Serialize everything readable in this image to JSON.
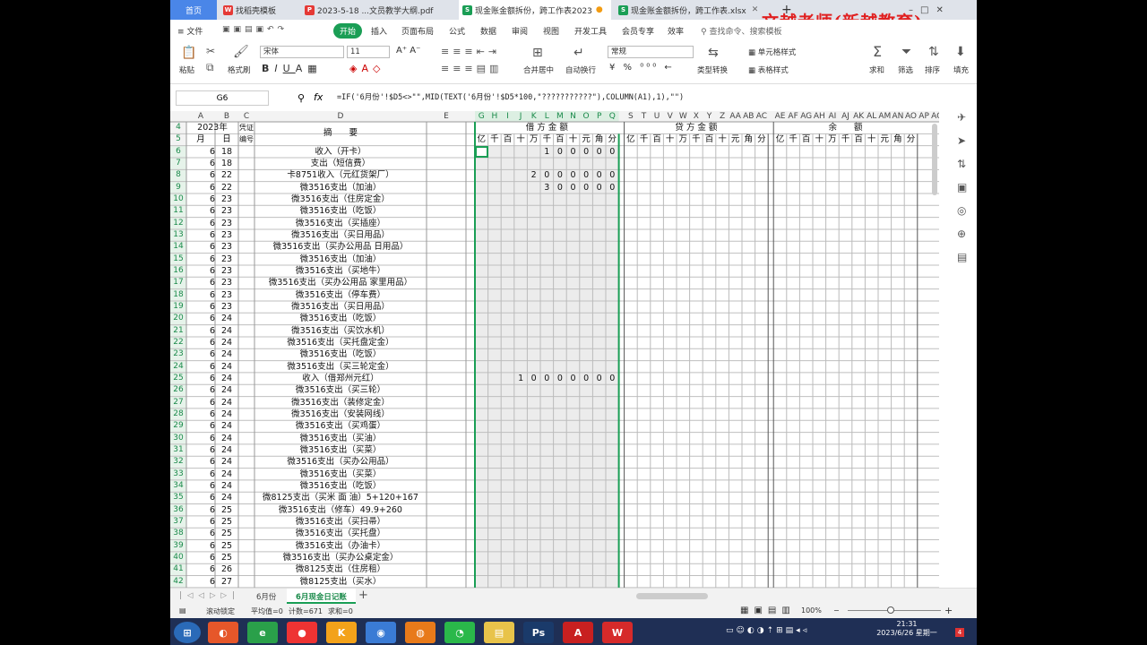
{
  "tabs": [
    {
      "label": "首页"
    },
    {
      "label": "找稻壳模板"
    },
    {
      "label": "2023-5-18 ...文员教学大纲.pdf"
    },
    {
      "label": "现金账金额拆份，跨工作表2023"
    },
    {
      "label": "现金账金额拆份，跨工作表.xlsx"
    }
  ],
  "watermark": "文越老师(新越教育)",
  "menu": {
    "file": "文件",
    "start": "开始",
    "items": [
      "插入",
      "页面布局",
      "公式",
      "数据",
      "审阅",
      "视图",
      "开发工具",
      "会员专享",
      "效率"
    ],
    "search": "查找命令、搜索模板"
  },
  "ribbon": {
    "paste": "粘贴",
    "format_painter": "格式刷",
    "font": "宋体",
    "size": "11",
    "merge": "合并居中",
    "wrap": "自动换行",
    "numfmt": "常规",
    "convert": "类型转换",
    "cond": "单元格样式",
    "table_style": "表格样式",
    "sum": "求和",
    "filter": "筛选",
    "sort": "排序",
    "fill": "填充"
  },
  "formula_bar": {
    "cell_ref": "G6",
    "fx": "fx",
    "formula": "=IF('6月份'!$D5<>\"\",MID(TEXT('6月份'!$D5*100,\"???????????\"),COLUMN(A1),1),\"\")"
  },
  "sheet": {
    "col_letters": [
      "A",
      "B",
      "C",
      "D",
      "E",
      "G",
      "H",
      "I",
      "J",
      "K",
      "L",
      "M",
      "N",
      "O",
      "P",
      "Q",
      "S",
      "T",
      "U",
      "V",
      "W",
      "X",
      "Y",
      "Z",
      "AA",
      "AB",
      "AC",
      "AE",
      "AF",
      "AG",
      "AH",
      "AI",
      "AJ",
      "AK",
      "AL",
      "AM",
      "AN",
      "AO",
      "AP",
      "AQ"
    ],
    "year": "2023年",
    "voucher": "凭证",
    "voucher2": "编号",
    "month": "月",
    "day": "日",
    "summary": "摘　　要",
    "debit": "借 方 金 额",
    "credit": "贷 方 金 额",
    "balance": "余　　额",
    "units": [
      "亿",
      "千",
      "百",
      "十",
      "万",
      "千",
      "百",
      "十",
      "元",
      "角",
      "分"
    ],
    "rows": [
      {
        "n": "6",
        "m": "6",
        "d": "18",
        "s": "收入（开卡）",
        "a": "100000"
      },
      {
        "n": "7",
        "m": "6",
        "d": "18",
        "s": "支出（短信费）",
        "a": ""
      },
      {
        "n": "8",
        "m": "6",
        "d": "22",
        "s": "卡8751收入（元红货架厂）",
        "a": "2000000"
      },
      {
        "n": "9",
        "m": "6",
        "d": "22",
        "s": "微3516支出（加油）",
        "a": "300000"
      },
      {
        "n": "10",
        "m": "6",
        "d": "23",
        "s": "微3516支出（住房定金）",
        "a": ""
      },
      {
        "n": "11",
        "m": "6",
        "d": "23",
        "s": "微3516支出（吃饭）",
        "a": ""
      },
      {
        "n": "12",
        "m": "6",
        "d": "23",
        "s": "微3516支出（买插座）",
        "a": ""
      },
      {
        "n": "13",
        "m": "6",
        "d": "23",
        "s": "微3516支出（买日用品）",
        "a": ""
      },
      {
        "n": "14",
        "m": "6",
        "d": "23",
        "s": "微3516支出（买办公用品 日用品）",
        "a": ""
      },
      {
        "n": "15",
        "m": "6",
        "d": "23",
        "s": "微3516支出（加油）",
        "a": ""
      },
      {
        "n": "16",
        "m": "6",
        "d": "23",
        "s": "微3516支出（买地牛）",
        "a": ""
      },
      {
        "n": "17",
        "m": "6",
        "d": "23",
        "s": "微3516支出（买办公用品 家里用品）",
        "a": ""
      },
      {
        "n": "18",
        "m": "6",
        "d": "23",
        "s": "微3516支出（停车费）",
        "a": ""
      },
      {
        "n": "19",
        "m": "6",
        "d": "23",
        "s": "微3516支出（买日用品）",
        "a": ""
      },
      {
        "n": "20",
        "m": "6",
        "d": "24",
        "s": "微3516支出（吃饭）",
        "a": ""
      },
      {
        "n": "21",
        "m": "6",
        "d": "24",
        "s": "微3516支出（买饮水机）",
        "a": ""
      },
      {
        "n": "22",
        "m": "6",
        "d": "24",
        "s": "微3516支出（买托盘定金）",
        "a": ""
      },
      {
        "n": "23",
        "m": "6",
        "d": "24",
        "s": "微3516支出（吃饭）",
        "a": ""
      },
      {
        "n": "24",
        "m": "6",
        "d": "24",
        "s": "微3516支出（买三轮定金）",
        "a": ""
      },
      {
        "n": "25",
        "m": "6",
        "d": "24",
        "s": "收入（借郑州元红）",
        "a": "10000000"
      },
      {
        "n": "26",
        "m": "6",
        "d": "24",
        "s": "微3516支出（买三轮）",
        "a": ""
      },
      {
        "n": "27",
        "m": "6",
        "d": "24",
        "s": "微3516支出（装修定金）",
        "a": ""
      },
      {
        "n": "28",
        "m": "6",
        "d": "24",
        "s": "微3516支出（安装网线）",
        "a": ""
      },
      {
        "n": "29",
        "m": "6",
        "d": "24",
        "s": "微3516支出（买鸡蛋）",
        "a": ""
      },
      {
        "n": "30",
        "m": "6",
        "d": "24",
        "s": "微3516支出（买油）",
        "a": ""
      },
      {
        "n": "31",
        "m": "6",
        "d": "24",
        "s": "微3516支出（买菜）",
        "a": ""
      },
      {
        "n": "32",
        "m": "6",
        "d": "24",
        "s": "微3516支出（买办公用品）",
        "a": ""
      },
      {
        "n": "33",
        "m": "6",
        "d": "24",
        "s": "微3516支出（买菜）",
        "a": ""
      },
      {
        "n": "34",
        "m": "6",
        "d": "24",
        "s": "微3516支出（吃饭）",
        "a": ""
      },
      {
        "n": "35",
        "m": "6",
        "d": "24",
        "s": "微8125支出（买米 面 油）5+120+167",
        "a": ""
      },
      {
        "n": "36",
        "m": "6",
        "d": "25",
        "s": "微3516支出（修车）49.9+260",
        "a": ""
      },
      {
        "n": "37",
        "m": "6",
        "d": "25",
        "s": "微3516支出（买扫帚）",
        "a": ""
      },
      {
        "n": "38",
        "m": "6",
        "d": "25",
        "s": "微3516支出（买托盘）",
        "a": ""
      },
      {
        "n": "39",
        "m": "6",
        "d": "25",
        "s": "微3516支出（办油卡）",
        "a": ""
      },
      {
        "n": "40",
        "m": "6",
        "d": "25",
        "s": "微3516支出（买办公桌定金）",
        "a": ""
      },
      {
        "n": "41",
        "m": "6",
        "d": "26",
        "s": "微8125支出（住房租）",
        "a": ""
      },
      {
        "n": "42",
        "m": "6",
        "d": "27",
        "s": "微8125支出（买水）",
        "a": ""
      }
    ]
  },
  "sheet_tabs": [
    "6月份",
    "6月现金日记账"
  ],
  "status": {
    "mode": "滚动锁定",
    "avg": "平均值=0",
    "count": "计数=671",
    "sum": "求和=0",
    "zoom": "100%"
  },
  "clock": {
    "time": "21:31",
    "date": "2023/6/26 星期一"
  }
}
